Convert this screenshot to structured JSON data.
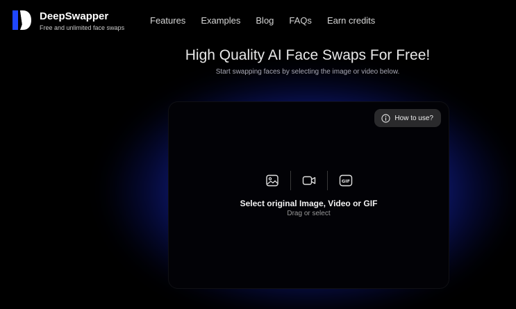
{
  "brand": {
    "name": "DeepSwapper",
    "tagline": "Free and unlimited face swaps"
  },
  "nav": {
    "items": [
      "Features",
      "Examples",
      "Blog",
      "FAQs",
      "Earn credits"
    ]
  },
  "hero": {
    "title": "High Quality AI Face Swaps For Free!",
    "subtitle": "Start swapping faces by selecting the image or video below."
  },
  "upload": {
    "howto_label": "How to use?",
    "media_types": [
      {
        "icon": "image-icon"
      },
      {
        "icon": "video-camera-icon"
      },
      {
        "icon": "gif-icon"
      }
    ],
    "title": "Select original Image, Video or GIF",
    "subtitle": "Drag or select"
  },
  "colors": {
    "background": "#000000",
    "glow": "#2846ff",
    "card": "#020206",
    "button": "#2a2a2c"
  }
}
